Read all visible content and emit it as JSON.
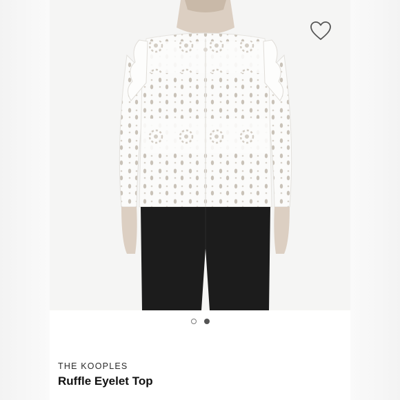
{
  "product": {
    "brand": "THE KOOPLES",
    "name": "Ruffle Eyelet Top"
  },
  "carousel": {
    "image_count": 2,
    "active_index": 1
  },
  "icons": {
    "favorite": "heart-outline-icon"
  },
  "colors": {
    "accent_dot": "#555555",
    "text": "#111111",
    "photo_bg": "#f5f5f4"
  }
}
